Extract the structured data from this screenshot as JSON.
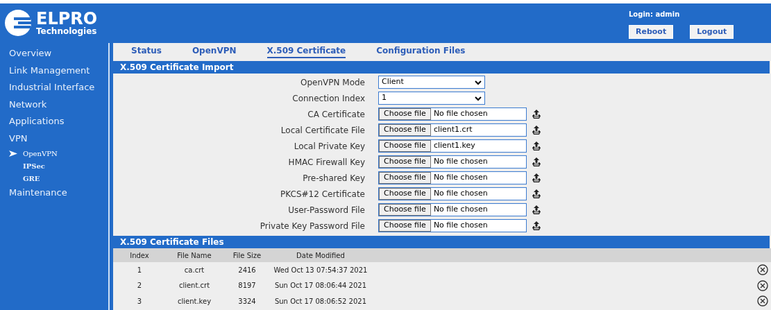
{
  "header": {
    "logo_title": "ELPRO",
    "logo_subtitle": "Technologies",
    "login": "Login: admin",
    "buttons": [
      "Reboot",
      "Logout"
    ]
  },
  "sidebar": {
    "items": [
      {
        "label": "Overview"
      },
      {
        "label": "Link Management"
      },
      {
        "label": "Industrial Interface"
      },
      {
        "label": "Network"
      },
      {
        "label": "Applications"
      },
      {
        "label": "VPN",
        "children": [
          {
            "label": "OpenVPN",
            "selected": true
          },
          {
            "label": "IPSec",
            "selected": false
          },
          {
            "label": "GRE",
            "selected": false
          }
        ]
      },
      {
        "label": "Maintenance"
      }
    ]
  },
  "tabs": [
    {
      "label": "Status",
      "selected": false
    },
    {
      "label": "OpenVPN",
      "selected": false
    },
    {
      "label": "X.509 Certificate",
      "selected": true
    },
    {
      "label": "Configuration Files",
      "selected": false
    }
  ],
  "import_section": {
    "title": "X.509 Certificate Import",
    "fields": [
      {
        "kind": "select",
        "label": "OpenVPN Mode",
        "value": "Client"
      },
      {
        "kind": "select",
        "label": "Connection Index",
        "value": "1"
      },
      {
        "kind": "file",
        "label": "CA Certificate",
        "button": "Choose file",
        "value": "No file chosen"
      },
      {
        "kind": "file",
        "label": "Local Certificate File",
        "button": "Choose file",
        "value": "client1.crt"
      },
      {
        "kind": "file",
        "label": "Local Private Key",
        "button": "Choose file",
        "value": "client1.key"
      },
      {
        "kind": "file",
        "label": "HMAC Firewall Key",
        "button": "Choose file",
        "value": "No file chosen"
      },
      {
        "kind": "file",
        "label": "Pre-shared Key",
        "button": "Choose file",
        "value": "No file chosen"
      },
      {
        "kind": "file",
        "label": "PKCS#12 Certificate",
        "button": "Choose file",
        "value": "No file chosen"
      },
      {
        "kind": "file",
        "label": "User-Password File",
        "button": "Choose file",
        "value": "No file chosen"
      },
      {
        "kind": "file",
        "label": "Private Key Password File",
        "button": "Choose file",
        "value": "No file chosen"
      }
    ]
  },
  "files_section": {
    "title": "X.509 Certificate Files",
    "columns": [
      "Index",
      "File Name",
      "File Size",
      "Date Modified"
    ],
    "rows": [
      [
        "1",
        "ca.crt",
        "2416",
        "Wed Oct 13 07:54:37 2021"
      ],
      [
        "2",
        "client.crt",
        "8197",
        "Sun Oct 17 08:06:44 2021"
      ],
      [
        "3",
        "client.key",
        "3324",
        "Sun Oct 17 08:06:52 2021"
      ]
    ]
  }
}
